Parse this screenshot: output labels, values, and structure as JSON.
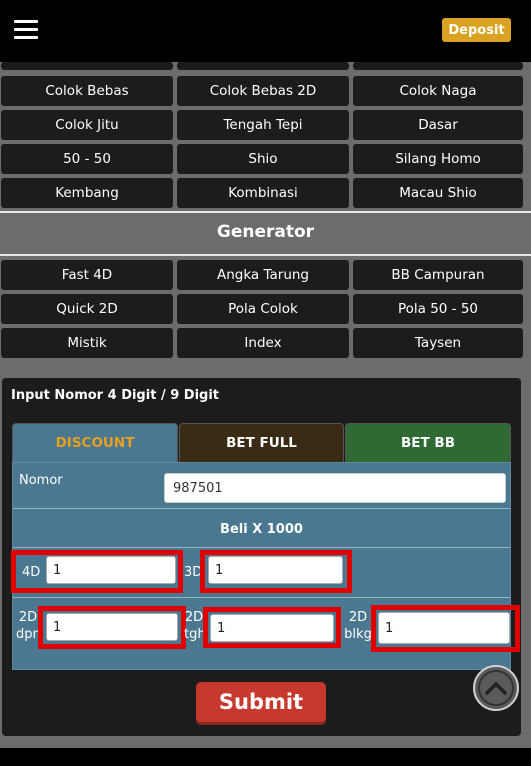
{
  "header": {
    "deposit_label": "Deposit"
  },
  "game_buttons": [
    [
      "Colok Bebas",
      "Colok Bebas 2D",
      "Colok Naga"
    ],
    [
      "Colok Jitu",
      "Tengah Tepi",
      "Dasar"
    ],
    [
      "50 - 50",
      "Shio",
      "Silang Homo"
    ],
    [
      "Kembang",
      "Kombinasi",
      "Macau Shio"
    ]
  ],
  "generator": {
    "title": "Generator",
    "buttons": [
      [
        "Fast 4D",
        "Angka Tarung",
        "BB Campuran"
      ],
      [
        "Quick 2D",
        "Pola Colok",
        "Pola 50 - 50"
      ],
      [
        "Mistik",
        "Index",
        "Taysen"
      ]
    ]
  },
  "panel": {
    "title": "Input Nomor 4 Digit / 9 Digit",
    "tabs": {
      "discount": "DISCOUNT",
      "bet_full": "BET FULL",
      "bet_bb": "BET BB"
    },
    "nomor_label": "Nomor",
    "nomor_value": "987501",
    "beli_label": "Beli X 1000",
    "fields": {
      "4d": {
        "label": "4D",
        "value": "1"
      },
      "3d": {
        "label": "3D",
        "value": "1"
      },
      "2d_dpn": {
        "label": "2D dpn",
        "value": "1"
      },
      "2d_tgh": {
        "label": "2D tgh",
        "value": "1"
      },
      "2d_blkg": {
        "label": "2D blkg",
        "value": "1"
      }
    }
  },
  "submit_label": "Submit",
  "colors": {
    "accent_gold": "#d9a321",
    "form_blue": "#4a7891",
    "bet_full_brown": "#3a2c14",
    "bet_bb_green": "#2f6934",
    "submit_red": "#c7382e",
    "highlight_red": "#e00000"
  },
  "icons": {
    "menu": "hamburger-icon",
    "scroll_top": "chevron-up-icon"
  }
}
